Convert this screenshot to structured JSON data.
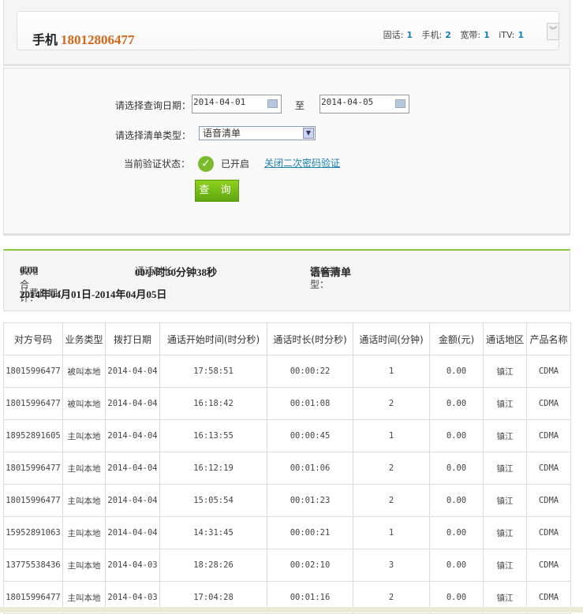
{
  "header": {
    "type_label": "手机",
    "number": "18012806477",
    "counts": [
      {
        "label": "固话:",
        "value": "1"
      },
      {
        "label": "手机:",
        "value": "2"
      },
      {
        "label": "宽带:",
        "value": "1"
      },
      {
        "label": "iTV:",
        "value": "1"
      }
    ],
    "expand_icon": "double-chevron-down"
  },
  "form": {
    "date_label": "请选择查询日期：",
    "start_date": "2014-04-01",
    "to_label": "至",
    "end_date": "2014-04-05",
    "type_label": "请选择清单类型：",
    "type_value": "语音清单",
    "verify_label": "当前验证状态：",
    "verify_status": "已开启",
    "verify_link": "关闭二次密码验证",
    "query_button": "查 询"
  },
  "summary": {
    "fee_label": "费用合计：",
    "fee": "0.00",
    "duration_label": "通话时长：",
    "duration": "00小时30分钟38秒",
    "type_label": "清单类型：",
    "type": "语音清单",
    "period_label": "计费日期：",
    "period": "2014年04月01日-2014年04月05日"
  },
  "table": {
    "headers": [
      "对方号码",
      "业务类型",
      "拨打日期",
      "通话开始时间(时分秒)",
      "通话时长(时分秒)",
      "通话时间(分钟)",
      "金额(元)",
      "通话地区",
      "产品名称"
    ],
    "rows": [
      [
        "18015996477",
        "被叫本地",
        "2014-04-04",
        "17:58:51",
        "00:00:22",
        "1",
        "0.00",
        "镇江",
        "CDMA"
      ],
      [
        "18015996477",
        "被叫本地",
        "2014-04-04",
        "16:18:42",
        "00:01:08",
        "2",
        "0.00",
        "镇江",
        "CDMA"
      ],
      [
        "18952891605",
        "主叫本地",
        "2014-04-04",
        "16:13:55",
        "00:00:45",
        "1",
        "0.00",
        "镇江",
        "CDMA"
      ],
      [
        "18015996477",
        "主叫本地",
        "2014-04-04",
        "16:12:19",
        "00:01:06",
        "2",
        "0.00",
        "镇江",
        "CDMA"
      ],
      [
        "18015996477",
        "主叫本地",
        "2014-04-04",
        "15:05:54",
        "00:01:23",
        "2",
        "0.00",
        "镇江",
        "CDMA"
      ],
      [
        "15952891063",
        "主叫本地",
        "2014-04-04",
        "14:31:45",
        "00:00:21",
        "1",
        "0.00",
        "镇江",
        "CDMA"
      ],
      [
        "13775538436",
        "主叫本地",
        "2014-04-03",
        "18:28:26",
        "00:02:10",
        "3",
        "0.00",
        "镇江",
        "CDMA"
      ],
      [
        "18015996477",
        "主叫本地",
        "2014-04-03",
        "17:04:28",
        "00:01:16",
        "2",
        "0.00",
        "镇江",
        "CDMA"
      ]
    ]
  }
}
